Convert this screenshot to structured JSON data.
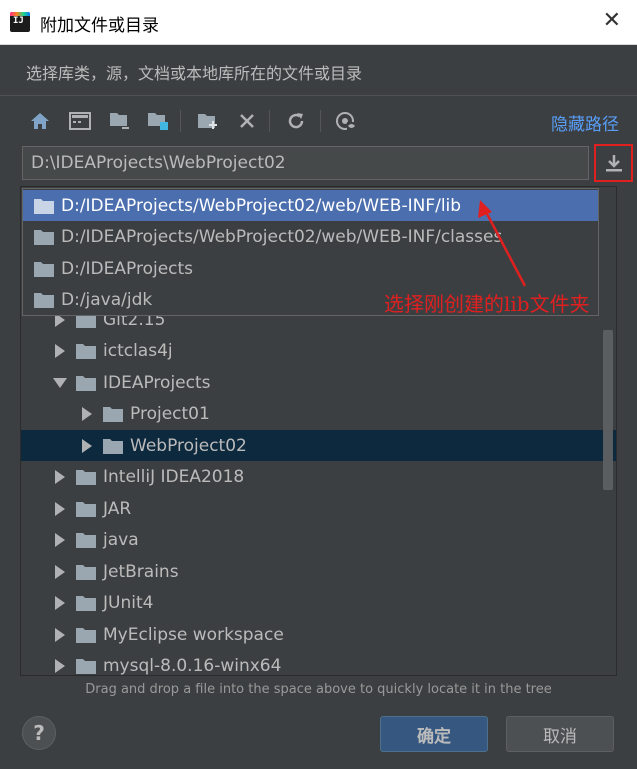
{
  "window": {
    "title": "附加文件或目录",
    "app_icon_text": "IJ"
  },
  "subtitle": "选择库类，源，文档或本地库所在的文件或目录",
  "toolbar": {
    "buttons": [
      "home-icon",
      "desktop-icon",
      "project-icon",
      "module-icon",
      "new-folder-icon",
      "delete-icon",
      "refresh-icon",
      "show-hidden-icon"
    ],
    "hide_path_label": "隐藏路径"
  },
  "path_field": {
    "value": "D:\\IDEAProjects\\WebProject02"
  },
  "popup": {
    "items": [
      {
        "label": "D:/IDEAProjects/WebProject02/web/WEB-INF/lib",
        "selected": true
      },
      {
        "label": "D:/IDEAProjects/WebProject02/web/WEB-INF/classes",
        "selected": false
      },
      {
        "label": "D:/IDEAProjects",
        "selected": false
      },
      {
        "label": "D:/java/jdk",
        "selected": false
      }
    ]
  },
  "tree": {
    "items": [
      {
        "label": "Git2.15",
        "expanded": false,
        "level": 0
      },
      {
        "label": "ictclas4j",
        "expanded": false,
        "level": 0
      },
      {
        "label": "IDEAProjects",
        "expanded": true,
        "level": 0
      },
      {
        "label": "Project01",
        "expanded": false,
        "level": 1
      },
      {
        "label": "WebProject02",
        "expanded": false,
        "level": 1,
        "selected": true
      },
      {
        "label": "IntelliJ IDEA2018",
        "expanded": false,
        "level": 0
      },
      {
        "label": "JAR",
        "expanded": false,
        "level": 0
      },
      {
        "label": "java",
        "expanded": false,
        "level": 0
      },
      {
        "label": "JetBrains",
        "expanded": false,
        "level": 0
      },
      {
        "label": "JUnit4",
        "expanded": false,
        "level": 0
      },
      {
        "label": "MyEclipse workspace",
        "expanded": false,
        "level": 0
      },
      {
        "label": "mysql-8.0.16-winx64",
        "expanded": false,
        "level": 0
      }
    ]
  },
  "annotation": {
    "text": "选择刚创建的lib文件夹",
    "color": "#e02020"
  },
  "hint": "Drag and drop a file into the space above to quickly locate it in the tree",
  "buttons": {
    "help": "?",
    "ok": "确定",
    "cancel": "取消"
  },
  "colors": {
    "background": "#3c3f41",
    "selection": "#4b6eaf",
    "tree_selection": "#0d293e",
    "link": "#589df6"
  }
}
